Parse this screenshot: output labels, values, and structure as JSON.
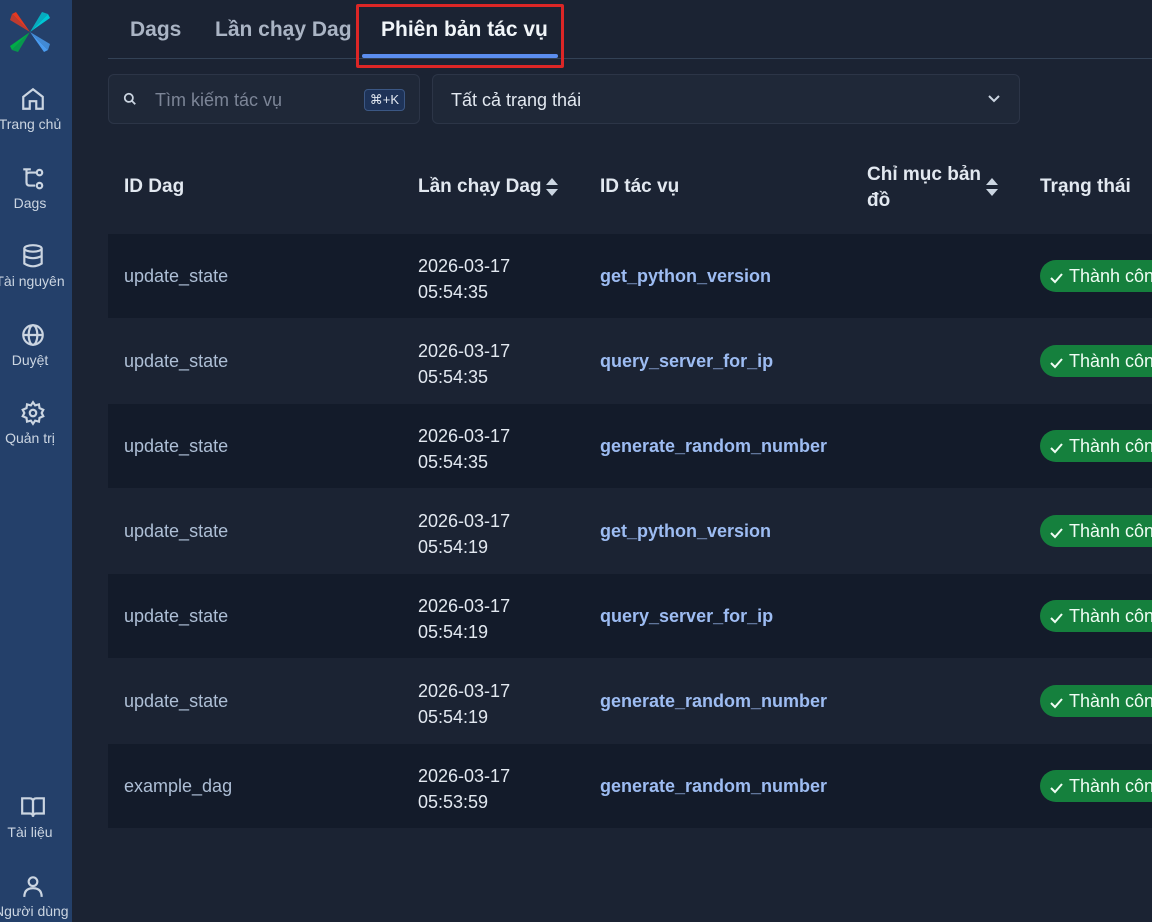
{
  "sidebar": {
    "items": [
      {
        "label": "Trang chủ",
        "icon": "home-icon"
      },
      {
        "label": "Dags",
        "icon": "dags-icon"
      },
      {
        "label": "Tài nguyên",
        "icon": "database-icon"
      },
      {
        "label": "Duyệt",
        "icon": "globe-icon"
      },
      {
        "label": "Quản trị",
        "icon": "gear-icon"
      }
    ],
    "bottom_items": [
      {
        "label": "Tài liệu",
        "icon": "book-icon"
      },
      {
        "label": "Người dùng",
        "icon": "user-icon"
      }
    ]
  },
  "tabs": [
    {
      "label": "Dags"
    },
    {
      "label": "Lần chạy Dag"
    },
    {
      "label": "Phiên bản tác vụ",
      "active": true
    }
  ],
  "search": {
    "placeholder": "Tìm kiếm tác vụ",
    "shortcut": "⌘+K"
  },
  "filter": {
    "value": "Tất cả trạng thái"
  },
  "table": {
    "headers": {
      "dag_id": "ID Dag",
      "dag_run": "Lần chạy Dag",
      "task_id": "ID tác vụ",
      "map_index_line1": "Chỉ mục bản",
      "map_index_line2": "đồ",
      "state": "Trạng thái"
    },
    "rows": [
      {
        "dag_id": "update_state",
        "date": "2026-03-17",
        "time": "05:54:35",
        "task_id": "get_python_version",
        "state": "Thành côn"
      },
      {
        "dag_id": "update_state",
        "date": "2026-03-17",
        "time": "05:54:35",
        "task_id": "query_server_for_ip",
        "state": "Thành côn"
      },
      {
        "dag_id": "update_state",
        "date": "2026-03-17",
        "time": "05:54:35",
        "task_id": "generate_random_number",
        "state": "Thành côn"
      },
      {
        "dag_id": "update_state",
        "date": "2026-03-17",
        "time": "05:54:19",
        "task_id": "get_python_version",
        "state": "Thành côn"
      },
      {
        "dag_id": "update_state",
        "date": "2026-03-17",
        "time": "05:54:19",
        "task_id": "query_server_for_ip",
        "state": "Thành côn"
      },
      {
        "dag_id": "update_state",
        "date": "2026-03-17",
        "time": "05:54:19",
        "task_id": "generate_random_number",
        "state": "Thành côn"
      },
      {
        "dag_id": "example_dag",
        "date": "2026-03-17",
        "time": "05:53:59",
        "task_id": "generate_random_number",
        "state": "Thành côn"
      }
    ]
  },
  "colors": {
    "sidebar": "#24406a",
    "background": "#1b2333",
    "accent": "#5b8def",
    "success": "#15803d",
    "highlight": "#dc2626"
  }
}
